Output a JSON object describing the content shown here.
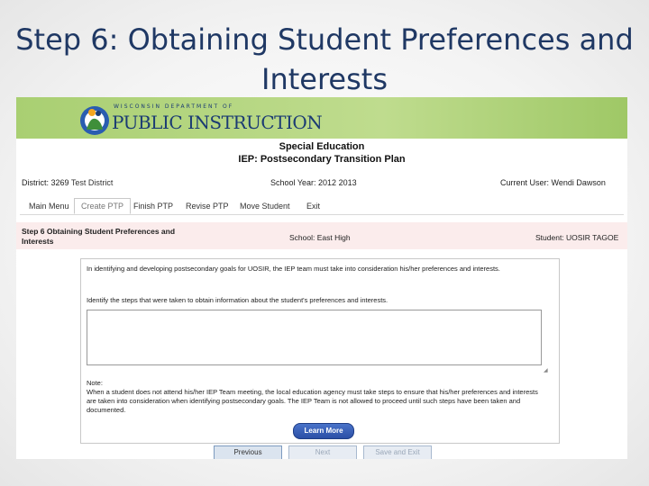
{
  "slide": {
    "title": "Step 6: Obtaining Student Preferences and Interests"
  },
  "banner": {
    "logo_top": "WISCONSIN DEPARTMENT OF",
    "logo_main": "PUBLIC INSTRUCTION"
  },
  "header": {
    "line1": "Special Education",
    "line2": "IEP: Postsecondary Transition Plan"
  },
  "info": {
    "district_label": "District:",
    "district_code": "3269",
    "district_name": "Test District",
    "school_year": "School Year: 2012   2013",
    "current_user": "Current User: Wendi Dawson"
  },
  "tabs": [
    "Main Menu",
    "Create PTP",
    "Finish PTP",
    "Revise PTP",
    "Move Student",
    "Exit"
  ],
  "step": {
    "title_line1": "Step 6   Obtaining Student Preferences and",
    "title_line2": "Interests",
    "school": "School: East High",
    "student": "Student: UOSIR TAGOE"
  },
  "panel": {
    "intro": "In identifying and developing postsecondary goals for UOSIR, the IEP team must take into consideration his/her preferences and interests.",
    "prompt": "Identify the steps that were taken to obtain information about the student's preferences and interests.",
    "textarea_value": "",
    "note_label": "Note:",
    "note_text": "When a student does not attend his/her IEP Team meeting, the local education agency must take steps to ensure that his/her preferences and interests are taken into consideration when identifying postsecondary goals. The IEP Team is not allowed to proceed until such steps have been taken and documented.",
    "learn_more": "Learn More"
  },
  "nav": {
    "previous": "Previous",
    "next": "Next",
    "save_exit": "Save and Exit"
  },
  "colors": {
    "banner": "#b5d67f",
    "title": "#1f3864",
    "step_bar": "#fbecec",
    "learn_more": "#2b4fa6"
  }
}
